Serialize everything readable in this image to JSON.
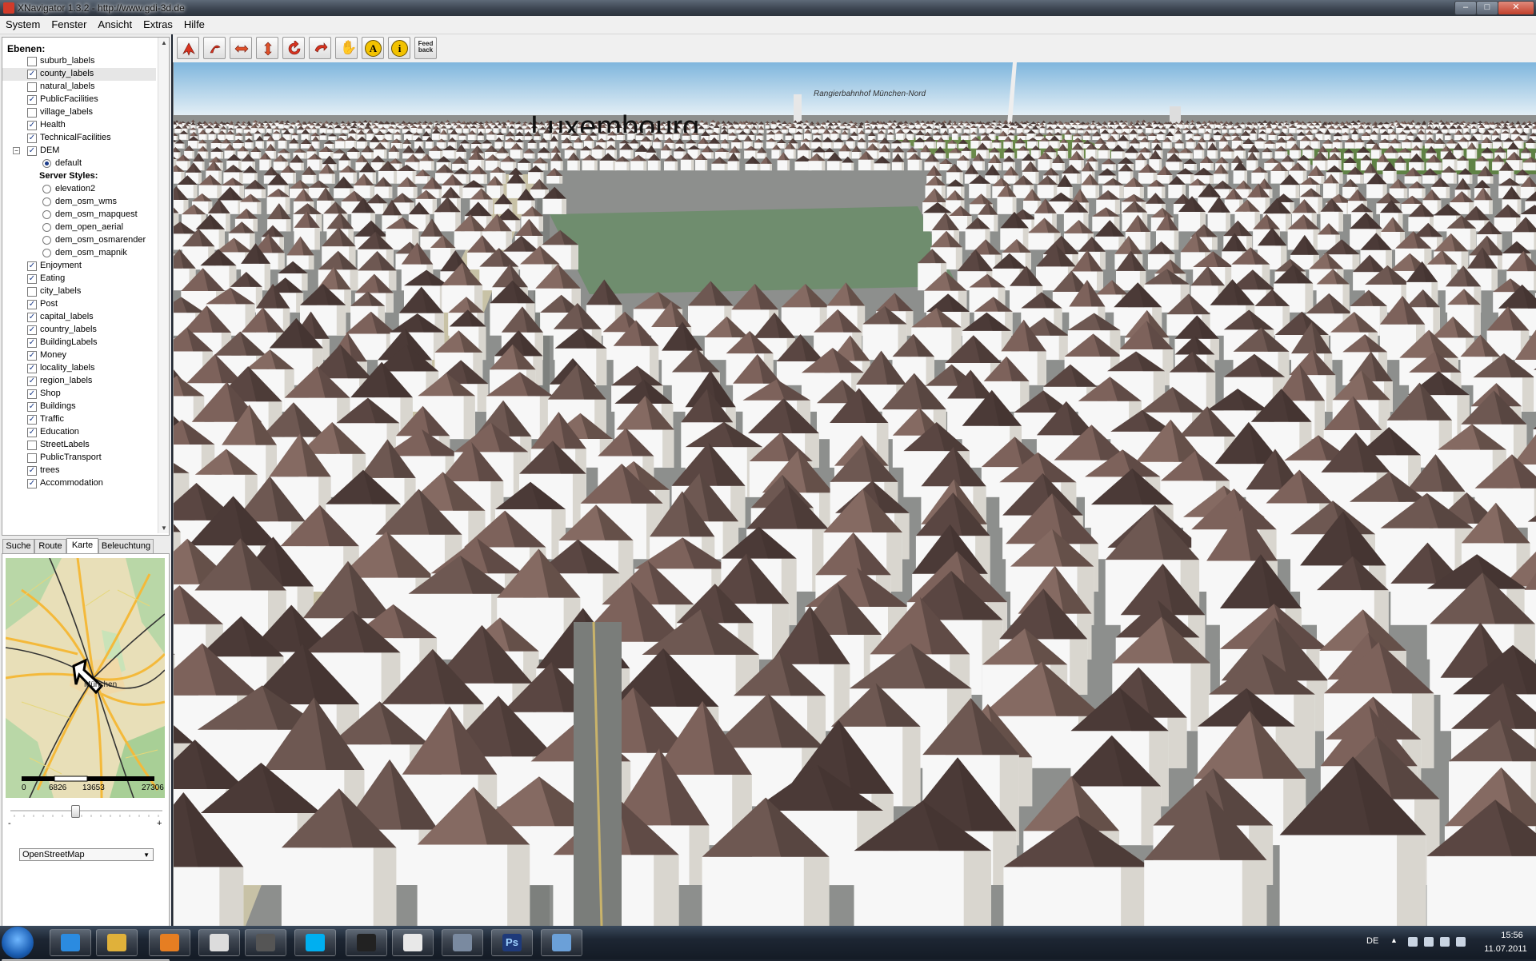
{
  "window": {
    "title": "XNavigator 1.3.2 - http://www.gdi-3d.de"
  },
  "menu": [
    "System",
    "Fenster",
    "Ansicht",
    "Extras",
    "Hilfe"
  ],
  "layers": {
    "title": "Ebenen:",
    "items": [
      {
        "label": "suburb_labels",
        "checked": false
      },
      {
        "label": "county_labels",
        "checked": true,
        "selected": true
      },
      {
        "label": "natural_labels",
        "checked": false
      },
      {
        "label": "PublicFacilities",
        "checked": true
      },
      {
        "label": "village_labels",
        "checked": false
      },
      {
        "label": "Health",
        "checked": true
      },
      {
        "label": "TechnicalFacilities",
        "checked": true
      },
      {
        "label": "DEM",
        "checked": true,
        "expanded": true
      },
      {
        "label": "default",
        "radio": true,
        "on": true
      },
      {
        "label": "Server Styles:",
        "header": true
      },
      {
        "label": "elevation2",
        "radio": true
      },
      {
        "label": "dem_osm_wms",
        "radio": true
      },
      {
        "label": "dem_osm_mapquest",
        "radio": true
      },
      {
        "label": "dem_open_aerial",
        "radio": true
      },
      {
        "label": "dem_osm_osmarender",
        "radio": true
      },
      {
        "label": "dem_osm_mapnik",
        "radio": true
      },
      {
        "label": "Enjoyment",
        "checked": true
      },
      {
        "label": "Eating",
        "checked": true
      },
      {
        "label": "city_labels",
        "checked": false
      },
      {
        "label": "Post",
        "checked": true
      },
      {
        "label": "capital_labels",
        "checked": true
      },
      {
        "label": "country_labels",
        "checked": true
      },
      {
        "label": "BuildingLabels",
        "checked": true
      },
      {
        "label": "Money",
        "checked": true
      },
      {
        "label": "locality_labels",
        "checked": true
      },
      {
        "label": "region_labels",
        "checked": true
      },
      {
        "label": "Shop",
        "checked": true
      },
      {
        "label": "Buildings",
        "checked": true
      },
      {
        "label": "Traffic",
        "checked": true
      },
      {
        "label": "Education",
        "checked": true
      },
      {
        "label": "StreetLabels",
        "checked": false
      },
      {
        "label": "PublicTransport",
        "checked": false
      },
      {
        "label": "trees",
        "checked": true
      },
      {
        "label": "Accommodation",
        "checked": true
      }
    ]
  },
  "tabs": [
    {
      "label": "Suche"
    },
    {
      "label": "Route"
    },
    {
      "label": "Karte",
      "active": true
    },
    {
      "label": "Beleuchtung"
    }
  ],
  "minimap": {
    "city_label": "München",
    "scale_ticks": [
      "0",
      "6826",
      "13653",
      "27306"
    ]
  },
  "zoom": {
    "minus": "-",
    "plus": "+",
    "level": 0.42
  },
  "map_select": {
    "value": "OpenStreetMap"
  },
  "toolbar_icons": [
    "fly-up-icon",
    "fly-down-icon",
    "move-horizontal-icon",
    "move-vertical-icon",
    "rotate-icon",
    "turn-icon",
    "hand-pan-icon",
    "annotation-icon",
    "info-icon",
    "feedback-icon"
  ],
  "toolbar": {
    "feedback_label": "Feed back"
  },
  "scene": {
    "label_big": "Luxembourg",
    "label_station": "Rangierbahnhof München-Nord"
  },
  "colors": {
    "roof": "#6e5852",
    "wall": "#f7f7f7",
    "street": "#8d8f8d",
    "sky_top": "#7fb6dd",
    "sky_bottom": "#e9f2f7"
  },
  "taskbar": {
    "apps": [
      "internet-explorer-icon",
      "explorer-folder-icon",
      "media-player-icon",
      "notepad-icon",
      "app-icon",
      "skype-icon",
      "console-icon",
      "java-icon",
      "paint-icon",
      "photoshop-icon",
      "image-viewer-icon"
    ],
    "photoshop_label": "Ps",
    "language": "DE",
    "time": "15:56",
    "date": "11.07.2011"
  }
}
